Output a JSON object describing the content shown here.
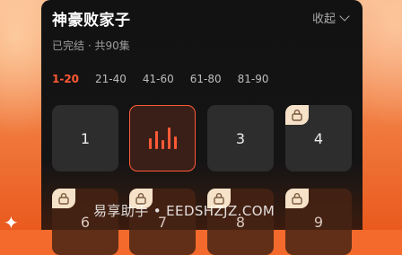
{
  "drama": {
    "title": "神豪败家子",
    "status": "已完结 · 共90集",
    "collapse_label": "收起"
  },
  "episode_ranges": [
    "1-20",
    "21-40",
    "41-60",
    "61-80",
    "81-90"
  ],
  "active_range": "1-20",
  "episodes": {
    "row1": [
      {
        "label": "1",
        "state": "unlocked"
      },
      {
        "label": "",
        "state": "playing"
      },
      {
        "label": "3",
        "state": "unlocked"
      },
      {
        "label": "4",
        "state": "locked"
      }
    ],
    "row2": [
      {
        "label": "6",
        "state": "locked"
      },
      {
        "label": "7",
        "state": "locked"
      },
      {
        "label": "8",
        "state": "locked"
      },
      {
        "label": "9",
        "state": "locked"
      }
    ]
  },
  "watermark": "易享助手 • EEDSHZJZ.COM",
  "colors": {
    "accent": "#ff5a35",
    "panel": "#121212",
    "lock_badge": "#f6e2c8"
  }
}
